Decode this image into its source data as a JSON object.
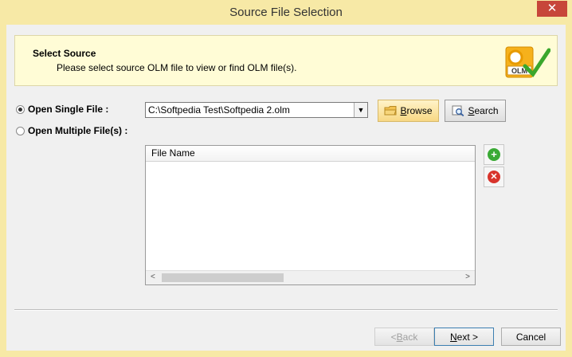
{
  "window": {
    "title": "Source File Selection",
    "close_glyph": "✕"
  },
  "header": {
    "title": "Select Source",
    "description": "Please select source OLM file to view or find OLM file(s).",
    "logo_text": "OLM",
    "logo_icon": "olm-checkmark-icon"
  },
  "options": {
    "single": {
      "label": "Open Single File :",
      "checked": true
    },
    "multiple": {
      "label": "Open Multiple File(s) :",
      "checked": false
    }
  },
  "file_path": {
    "value": "C:\\Softpedia Test\\Softpedia 2.olm"
  },
  "buttons": {
    "browse": {
      "mnemonic": "B",
      "rest": "rowse"
    },
    "search": {
      "mnemonic": "S",
      "rest": "earch"
    },
    "add_glyph": "+",
    "remove_glyph": "✕"
  },
  "file_list": {
    "column_header": "File Name",
    "rows": []
  },
  "scroll": {
    "left_glyph": "<",
    "right_glyph": ">"
  },
  "nav": {
    "back": {
      "prefix": "< ",
      "mnemonic": "B",
      "rest": "ack",
      "disabled": true
    },
    "next": {
      "mnemonic": "N",
      "rest": "ext >"
    },
    "cancel": "Cancel"
  },
  "colors": {
    "titlebar": "#f7e9a6",
    "header_panel": "#fffcd6",
    "close_button": "#c7463a",
    "add_icon": "#3aaa35",
    "remove_icon": "#d8342c",
    "browse_highlight": "#f8d884"
  }
}
